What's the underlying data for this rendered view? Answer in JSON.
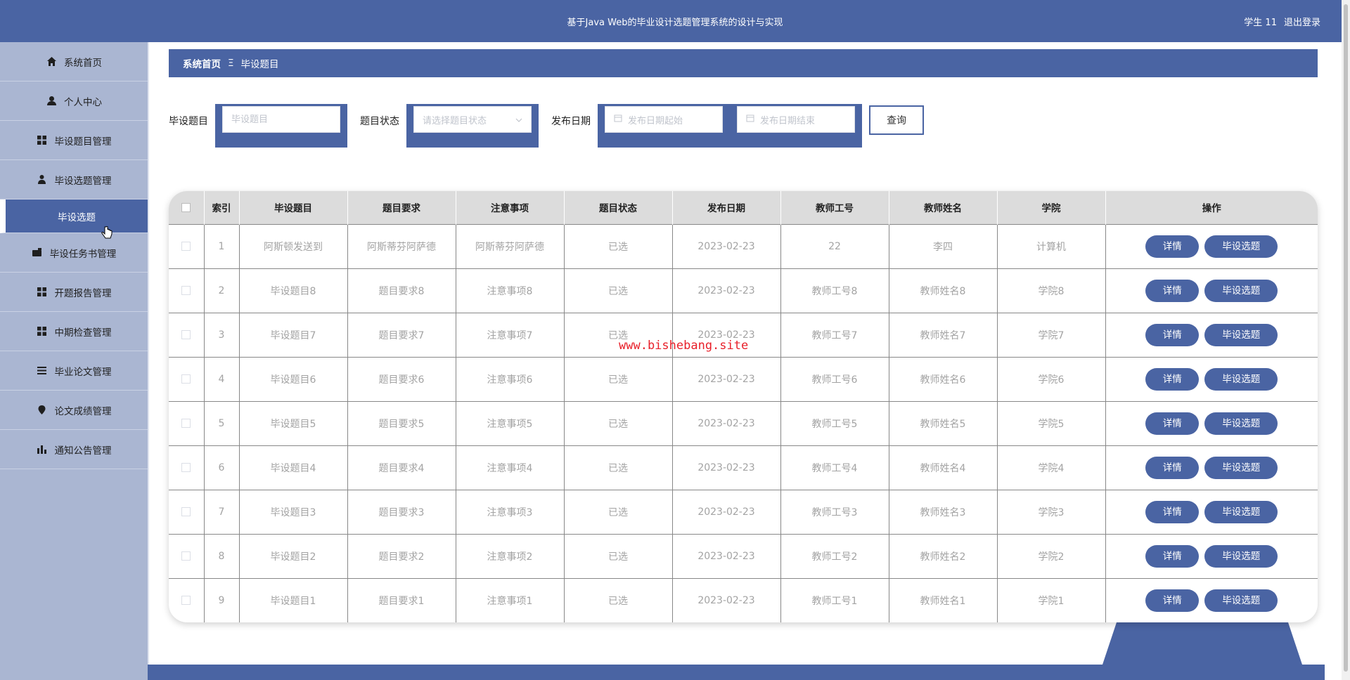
{
  "header": {
    "title": "基于Java Web的毕业设计选题管理系统的设计与实现",
    "user": "学生 11",
    "logout": "退出登录"
  },
  "sidebar": {
    "items": [
      {
        "label": "系统首页",
        "icon": "home-icon"
      },
      {
        "label": "个人中心",
        "icon": "user-icon"
      },
      {
        "label": "毕设题目管理",
        "icon": "grid-icon"
      },
      {
        "label": "毕设选题管理",
        "icon": "person-icon"
      },
      {
        "label": "毕设选题",
        "icon": "",
        "active": true
      },
      {
        "label": "毕设任务书管理",
        "icon": "wallet-icon"
      },
      {
        "label": "开题报告管理",
        "icon": "grid-icon"
      },
      {
        "label": "中期检查管理",
        "icon": "grid-icon"
      },
      {
        "label": "毕业论文管理",
        "icon": "list-icon"
      },
      {
        "label": "论文成绩管理",
        "icon": "location-pin-icon"
      },
      {
        "label": "通知公告管理",
        "icon": "bar-chart-icon"
      }
    ]
  },
  "breadcrumb": {
    "home": "系统首页",
    "separator": "Ξ",
    "current": "毕设题目"
  },
  "search": {
    "topic_label": "毕设题目",
    "topic_placeholder": "毕设题目",
    "status_label": "题目状态",
    "status_placeholder": "请选择题目状态",
    "date_label": "发布日期",
    "date_start_placeholder": "发布日期起始",
    "date_end_placeholder": "发布日期结束",
    "query_button": "查询"
  },
  "table": {
    "columns": [
      "索引",
      "毕设题目",
      "题目要求",
      "注意事项",
      "题目状态",
      "发布日期",
      "教师工号",
      "教师姓名",
      "学院",
      "操作"
    ],
    "rows": [
      [
        "1",
        "阿斯顿发送到",
        "阿斯蒂芬阿萨德",
        "阿斯蒂芬阿萨德",
        "已选",
        "2023-02-23",
        "22",
        "李四",
        "计算机"
      ],
      [
        "2",
        "毕设题目8",
        "题目要求8",
        "注意事项8",
        "已选",
        "2023-02-23",
        "教师工号8",
        "教师姓名8",
        "学院8"
      ],
      [
        "3",
        "毕设题目7",
        "题目要求7",
        "注意事项7",
        "已选",
        "2023-02-23",
        "教师工号7",
        "教师姓名7",
        "学院7"
      ],
      [
        "4",
        "毕设题目6",
        "题目要求6",
        "注意事项6",
        "已选",
        "2023-02-23",
        "教师工号6",
        "教师姓名6",
        "学院6"
      ],
      [
        "5",
        "毕设题目5",
        "题目要求5",
        "注意事项5",
        "已选",
        "2023-02-23",
        "教师工号5",
        "教师姓名5",
        "学院5"
      ],
      [
        "6",
        "毕设题目4",
        "题目要求4",
        "注意事项4",
        "已选",
        "2023-02-23",
        "教师工号4",
        "教师姓名4",
        "学院4"
      ],
      [
        "7",
        "毕设题目3",
        "题目要求3",
        "注意事项3",
        "已选",
        "2023-02-23",
        "教师工号3",
        "教师姓名3",
        "学院3"
      ],
      [
        "8",
        "毕设题目2",
        "题目要求2",
        "注意事项2",
        "已选",
        "2023-02-23",
        "教师工号2",
        "教师姓名2",
        "学院2"
      ],
      [
        "9",
        "毕设题目1",
        "题目要求1",
        "注意事项1",
        "已选",
        "2023-02-23",
        "教师工号1",
        "教师姓名1",
        "学院1"
      ]
    ],
    "detail_button": "详情",
    "select_button": "毕设选题"
  },
  "watermark": "www.bishebang.site",
  "colors": {
    "primary": "#4a64a3",
    "sidebar_bg": "#aab6d2",
    "header_row": "#dcdcdc",
    "watermark": "#e8202a"
  }
}
